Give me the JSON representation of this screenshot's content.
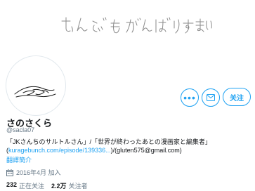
{
  "banner": {
    "handwriting": "むんぶ もがんばりすまい"
  },
  "profile": {
    "display_name": "さのさくら",
    "handle": "@sacla07",
    "bio_text_1": "「JKさんちのサルトルさん」/「世界が終わったあとの漫画家と編集者」(",
    "bio_link": "kuragebunch.com/episode/139336...",
    "bio_text_2": ")/(gluten575@gmail.com)",
    "translate_label": "翻譯簡介",
    "joined": "2016年4月 加入",
    "following_count": "232",
    "following_label": "正在关注",
    "followers_count": "2.2万",
    "followers_label": "关注者"
  },
  "actions": {
    "more_label": "•••",
    "follow_label": "关注"
  },
  "colors": {
    "accent": "#1da1f2",
    "muted": "#657786",
    "text": "#14171a"
  },
  "icons": {
    "more": "more-icon",
    "message": "envelope-icon",
    "calendar": "calendar-icon"
  }
}
